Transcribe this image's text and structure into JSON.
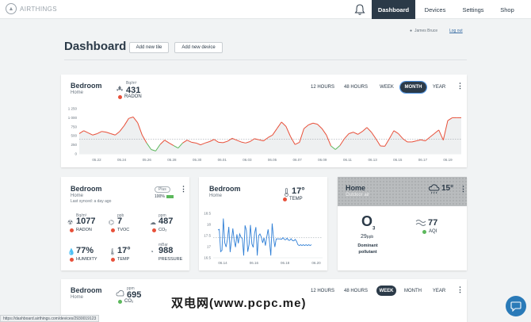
{
  "brand": "AIRTHINGS",
  "nav": {
    "dashboard": "Dashboard",
    "devices": "Devices",
    "settings": "Settings",
    "shop": "Shop"
  },
  "user": {
    "name": "James Bruce",
    "logout": "Log out"
  },
  "page": {
    "title": "Dashboard",
    "add_tile": "Add new tile",
    "add_device": "Add new device"
  },
  "main_tile": {
    "room": "Bedroom",
    "location": "Home",
    "unit": "Bq/m³",
    "value": "431",
    "sensor": "RADON",
    "ranges": [
      "12 HOURS",
      "48 HOURS",
      "WEEK",
      "MONTH",
      "YEAR"
    ],
    "selected_range": "MONTH"
  },
  "chart_data": {
    "type": "line",
    "title": "",
    "x_ticks": [
      "05.22",
      "05.24",
      "05.26",
      "05.28",
      "05.30",
      "06.01",
      "06.03",
      "06.05",
      "06.07",
      "06.09",
      "06.11",
      "06.13",
      "06.15",
      "06.17",
      "06.19"
    ],
    "y_ticks": [
      0,
      250,
      500,
      750,
      1000,
      1250
    ],
    "ylim": [
      0,
      1250
    ],
    "threshold": 400,
    "series": [
      {
        "values": [
          560,
          640,
          580,
          520,
          560,
          620,
          600,
          560,
          520,
          620,
          780,
          980,
          1020,
          860,
          520,
          300,
          120,
          80,
          260,
          380,
          300,
          230,
          160,
          300,
          380,
          320,
          300,
          250,
          300,
          340,
          400,
          320,
          310,
          350,
          430,
          380,
          330,
          300,
          340,
          420,
          390,
          360,
          450,
          520,
          700,
          880,
          760,
          480,
          260,
          320,
          700,
          800,
          850,
          820,
          700,
          520,
          220,
          120,
          230,
          420,
          560,
          600,
          540,
          620,
          730,
          600,
          420,
          220,
          210,
          420,
          640,
          560,
          420,
          330,
          330,
          360,
          390,
          360,
          460,
          560,
          660,
          380,
          920,
          1000,
          1000,
          1000
        ]
      }
    ]
  },
  "tile_detail": {
    "room": "Bedroom",
    "location": "Home",
    "plan": "Plus",
    "battery": "100%",
    "last_synced": "Last synced: a day ago",
    "metrics": [
      {
        "unit": "Bq/m³",
        "value": "1077",
        "label": "RADON",
        "status": "#e8503a"
      },
      {
        "unit": "ppb",
        "value": "7",
        "label": "TVOC",
        "status": "#e8503a"
      },
      {
        "unit": "ppm",
        "value": "487",
        "label": "CO₂",
        "status": "#e8503a"
      },
      {
        "unit": "",
        "value": "77%",
        "label": "HUMIDITY",
        "status": "#e8503a"
      },
      {
        "unit": "",
        "value": "17°",
        "label": "TEMP",
        "status": "#e8503a"
      },
      {
        "unit": "mBar",
        "value": "988",
        "label": "PRESSURE",
        "status": ""
      }
    ]
  },
  "tile_temp": {
    "room": "Bedroom",
    "location": "Home",
    "value": "17°",
    "label": "TEMP",
    "chart_data": {
      "type": "line",
      "x_ticks": [
        "06.14",
        "06.16",
        "06.18",
        "06.20"
      ],
      "y_ticks": [
        16.5,
        17,
        17.5,
        18,
        18.5
      ],
      "ylim": [
        16.5,
        18.5
      ]
    }
  },
  "tile_outdoor": {
    "room": "Home",
    "sub": "Outdoor air",
    "temp": "15°",
    "pollutant_symbol": "O",
    "pollutant_sub": "3",
    "pollutant_value": "29",
    "pollutant_unit": "ppb",
    "dominant_label": "Dominant pollutant",
    "aqi_value": "77",
    "aqi_label": "AQI"
  },
  "bottom_tile": {
    "room": "Bedroom",
    "location": "Home",
    "unit": "ppm",
    "value": "695",
    "sensor": "CO₂",
    "ranges": [
      "12 HOURS",
      "48 HOURS",
      "WEEK",
      "MONTH",
      "YEAR"
    ],
    "selected_range": "WEEK"
  },
  "status_url": "https://dashboard.airthings.com/devices/2930019123",
  "watermark": "双电网(www.pcpc.me)",
  "colors": {
    "red": "#e8503a",
    "green": "#5cb85c",
    "navy": "#2b3a48",
    "blue": "#2f7fd6"
  }
}
